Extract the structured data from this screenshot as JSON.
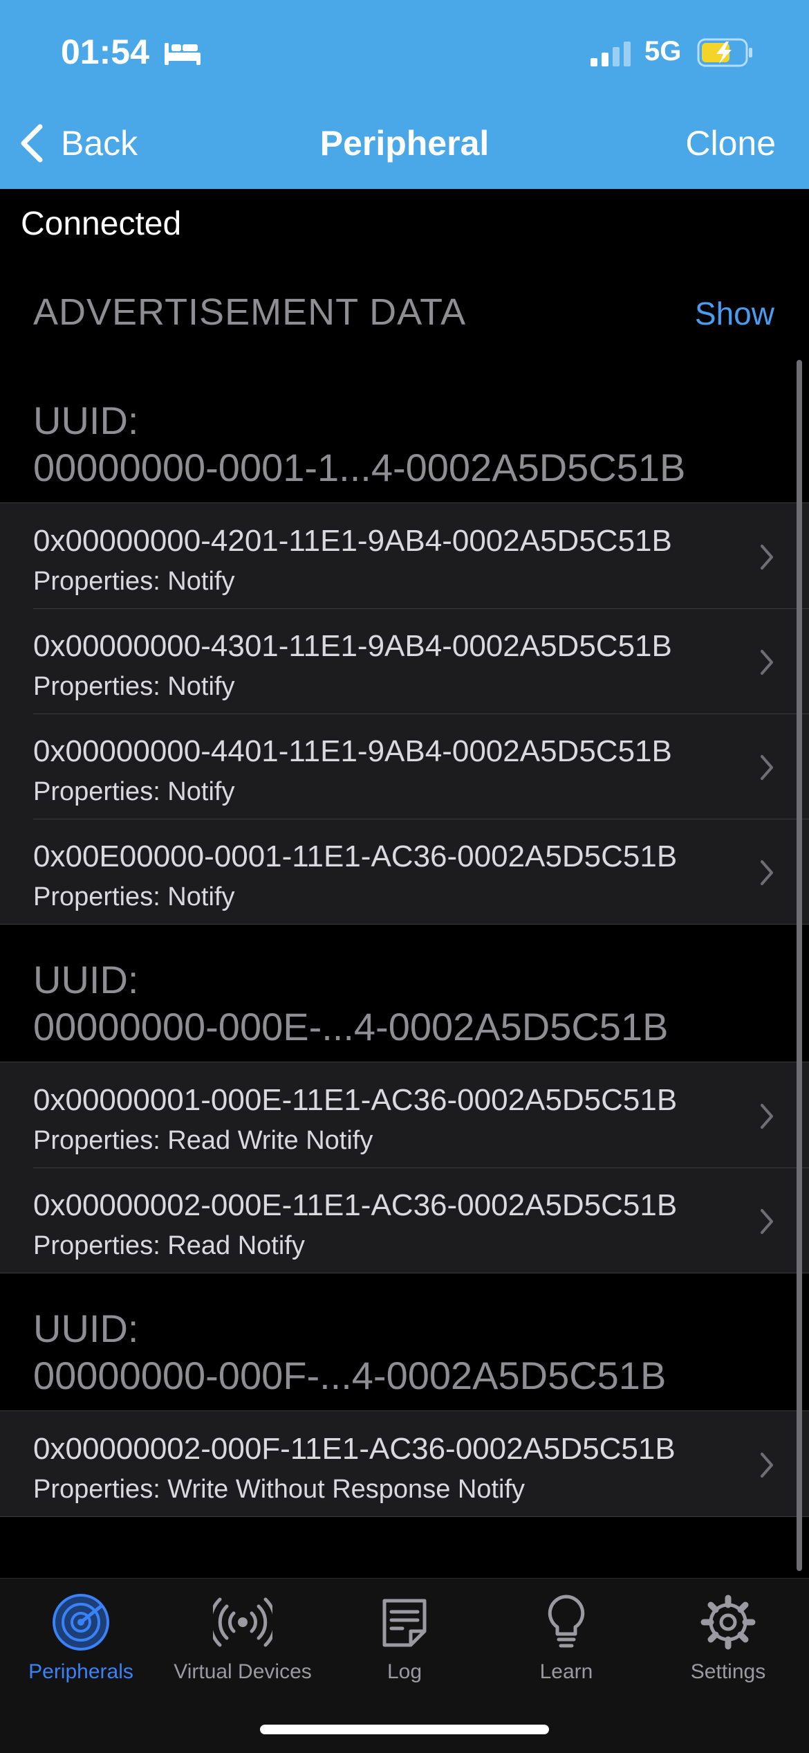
{
  "status_bar": {
    "time": "01:54",
    "network": "5G"
  },
  "nav": {
    "back_label": "Back",
    "title": "Peripheral",
    "action_label": "Clone"
  },
  "connection_status": "Connected",
  "advertisement": {
    "header": "ADVERTISEMENT DATA",
    "toggle_label": "Show"
  },
  "services": [
    {
      "header_line1": "UUID:",
      "header_line2": "00000000-0001-1...4-0002A5D5C51B",
      "characteristics": [
        {
          "uuid": "0x00000000-4201-11E1-9AB4-0002A5D5C51B",
          "properties": "Properties: Notify"
        },
        {
          "uuid": "0x00000000-4301-11E1-9AB4-0002A5D5C51B",
          "properties": "Properties: Notify"
        },
        {
          "uuid": "0x00000000-4401-11E1-9AB4-0002A5D5C51B",
          "properties": "Properties: Notify"
        },
        {
          "uuid": "0x00E00000-0001-11E1-AC36-0002A5D5C51B",
          "properties": "Properties: Notify"
        }
      ]
    },
    {
      "header_line1": "UUID:",
      "header_line2": "00000000-000E-...4-0002A5D5C51B",
      "characteristics": [
        {
          "uuid": "0x00000001-000E-11E1-AC36-0002A5D5C51B",
          "properties": "Properties: Read Write Notify"
        },
        {
          "uuid": "0x00000002-000E-11E1-AC36-0002A5D5C51B",
          "properties": "Properties: Read Notify"
        }
      ]
    },
    {
      "header_line1": "UUID:",
      "header_line2": "00000000-000F-...4-0002A5D5C51B",
      "characteristics": [
        {
          "uuid": "0x00000002-000F-11E1-AC36-0002A5D5C51B",
          "properties": "Properties: Write Without Response Notify"
        }
      ]
    }
  ],
  "tabs": [
    {
      "label": "Peripherals",
      "icon": "radar-icon",
      "active": true
    },
    {
      "label": "Virtual Devices",
      "icon": "broadcast-icon",
      "active": false
    },
    {
      "label": "Log",
      "icon": "log-icon",
      "active": false
    },
    {
      "label": "Learn",
      "icon": "lightbulb-icon",
      "active": false
    },
    {
      "label": "Settings",
      "icon": "gear-icon",
      "active": false
    }
  ],
  "colors": {
    "header": "#4aa8e8",
    "accent": "#3a82f7",
    "link": "#4a9cf0",
    "cell": "#1c1c1e"
  }
}
